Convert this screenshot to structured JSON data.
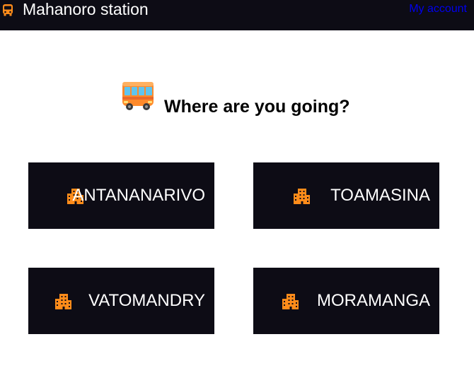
{
  "header": {
    "title": "Mahanoro station",
    "account_link": "My account",
    "brand_icon": "bus-icon"
  },
  "main": {
    "hero_icon": "bus-emoji-icon",
    "question": "Where are you going?"
  },
  "destinations": [
    {
      "label": "ANTANANARIVO",
      "icon": "city-icon"
    },
    {
      "label": "TOAMASINA",
      "icon": "city-icon"
    },
    {
      "label": "VATOMANDRY",
      "icon": "city-icon"
    },
    {
      "label": "MORAMANGA",
      "icon": "city-icon"
    }
  ],
  "colors": {
    "header_bg": "#0d0c15",
    "card_bg": "#0d0c15",
    "accent_orange": "#ff8c1a",
    "link": "#0000ee"
  }
}
